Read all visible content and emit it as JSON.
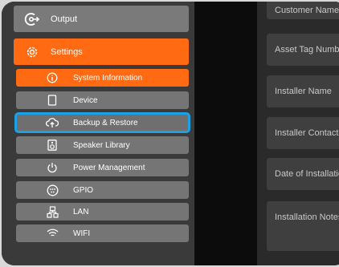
{
  "sidebar": {
    "output_label": "Output",
    "settings_label": "Settings",
    "items": [
      {
        "label": "System Information",
        "icon": "info-icon"
      },
      {
        "label": "Device",
        "icon": "device-icon"
      },
      {
        "label": "Backup & Restore",
        "icon": "cloud-upload-icon"
      },
      {
        "label": "Speaker Library",
        "icon": "speaker-icon"
      },
      {
        "label": "Power Management",
        "icon": "power-icon"
      },
      {
        "label": "GPIO",
        "icon": "gpio-icon"
      },
      {
        "label": "LAN",
        "icon": "network-icon"
      },
      {
        "label": "WIFI",
        "icon": "wifi-icon"
      }
    ]
  },
  "form": {
    "fields": [
      {
        "label": "Customer Name"
      },
      {
        "label": "Asset Tag Number"
      },
      {
        "label": "Installer Name"
      },
      {
        "label": "Installer Contact"
      },
      {
        "label": "Date of Installation"
      },
      {
        "label": "Installation Notes"
      }
    ]
  },
  "colors": {
    "accent": "#ff6a13",
    "selection_outline": "#1ba1e6",
    "nav_item": "#757575",
    "sidebar_bg": "#3a3a3a",
    "field_bg": "#3f3f3f"
  }
}
